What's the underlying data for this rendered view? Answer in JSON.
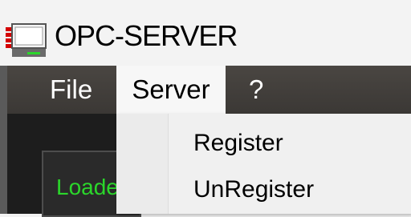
{
  "window": {
    "title": "OPC-SERVER",
    "icon": "opc-app-icon"
  },
  "menubar": {
    "items": [
      {
        "label": "File"
      },
      {
        "label": "Server"
      },
      {
        "label": "?"
      }
    ]
  },
  "server_menu": {
    "items": [
      {
        "label": "Register"
      },
      {
        "label": "UnRegister"
      }
    ]
  },
  "main": {
    "status_label": "Loade"
  },
  "colors": {
    "menubar": "#3f3c39",
    "window_body": "#1d1d1d",
    "status_text": "#2bd62b",
    "menu_open": "#f7f7f7"
  }
}
